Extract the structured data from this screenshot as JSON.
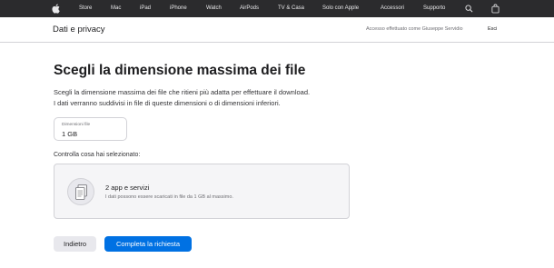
{
  "globalnav": {
    "items": [
      "Store",
      "Mac",
      "iPad",
      "iPhone",
      "Watch",
      "AirPods",
      "TV & Casa",
      "Solo con Apple",
      "Accessori",
      "Supporto"
    ],
    "icons": {
      "logo": "apple-logo-icon",
      "search": "search-icon",
      "bag": "shopping-bag-icon"
    }
  },
  "subnav": {
    "title": "Dati e privacy",
    "account_text": "Accesso effettuato come Giuseppe Servidio",
    "signout": "Esci"
  },
  "main": {
    "title": "Scegli la dimensione massima dei file",
    "desc_line_1": "Scegli la dimensione massima dei file che ritieni più adatta per effettuare il download.",
    "desc_line_2": "I dati verranno suddivisi in file di queste dimensioni o di dimensioni inferiori.",
    "select": {
      "label": "Dimensioni file",
      "value": "1 GB"
    },
    "check_label": "Controlla cosa hai selezionato:",
    "card": {
      "icon": "document-icon",
      "title": "2 app e servizi",
      "subtitle": "I dati possono essere scaricati in file da 1 GB al massimo."
    },
    "buttons": {
      "back": "Indietro",
      "submit": "Completa la richiesta"
    }
  },
  "colors": {
    "nav_bg": "#2b2b2d",
    "accent": "#0071e3",
    "card_bg": "#f5f5f7",
    "border": "#d2d2d7"
  }
}
